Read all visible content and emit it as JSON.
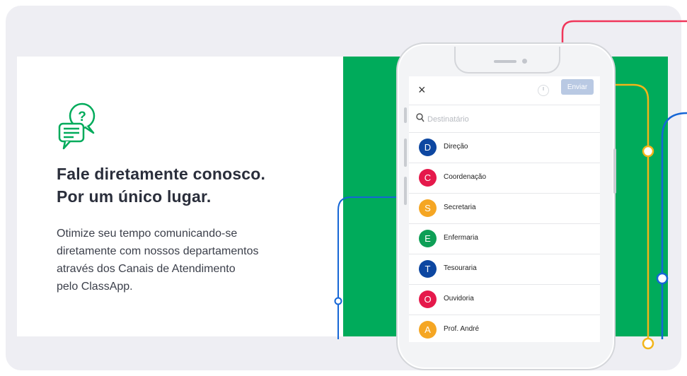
{
  "headline": [
    "Fale diretamente conosco.",
    "Por um único lugar."
  ],
  "description": [
    "Otimize seu tempo comunicando-se",
    "diretamente com nossos departamentos",
    "através dos Canais de Atendimento",
    "pelo ClassApp."
  ],
  "icons": {
    "chat": "chat-question-icon",
    "close": "close-icon",
    "clock": "clock-icon",
    "search": "search-icon"
  },
  "phone": {
    "close_label": "×",
    "send_label": "Enviar",
    "search_placeholder": "Destinatário",
    "recipients": [
      {
        "initial": "D",
        "label": "Direção",
        "color": "#0d47a1"
      },
      {
        "initial": "C",
        "label": "Coordenação",
        "color": "#e5194b"
      },
      {
        "initial": "S",
        "label": "Secretaria",
        "color": "#f5a623"
      },
      {
        "initial": "E",
        "label": "Enfermaria",
        "color": "#0e9f56"
      },
      {
        "initial": "T",
        "label": "Tesouraria",
        "color": "#0d47a1"
      },
      {
        "initial": "O",
        "label": "Ouvidoria",
        "color": "#e5194b"
      },
      {
        "initial": "A",
        "label": "Prof. André",
        "color": "#f5a623"
      }
    ]
  },
  "colors": {
    "accent_green": "#00ab5b",
    "frame": "#eeeef3",
    "send_disabled": "#b9c9e3",
    "line_red": "#f0365a",
    "line_yellow": "#f2b418",
    "line_blue": "#1566d6"
  }
}
